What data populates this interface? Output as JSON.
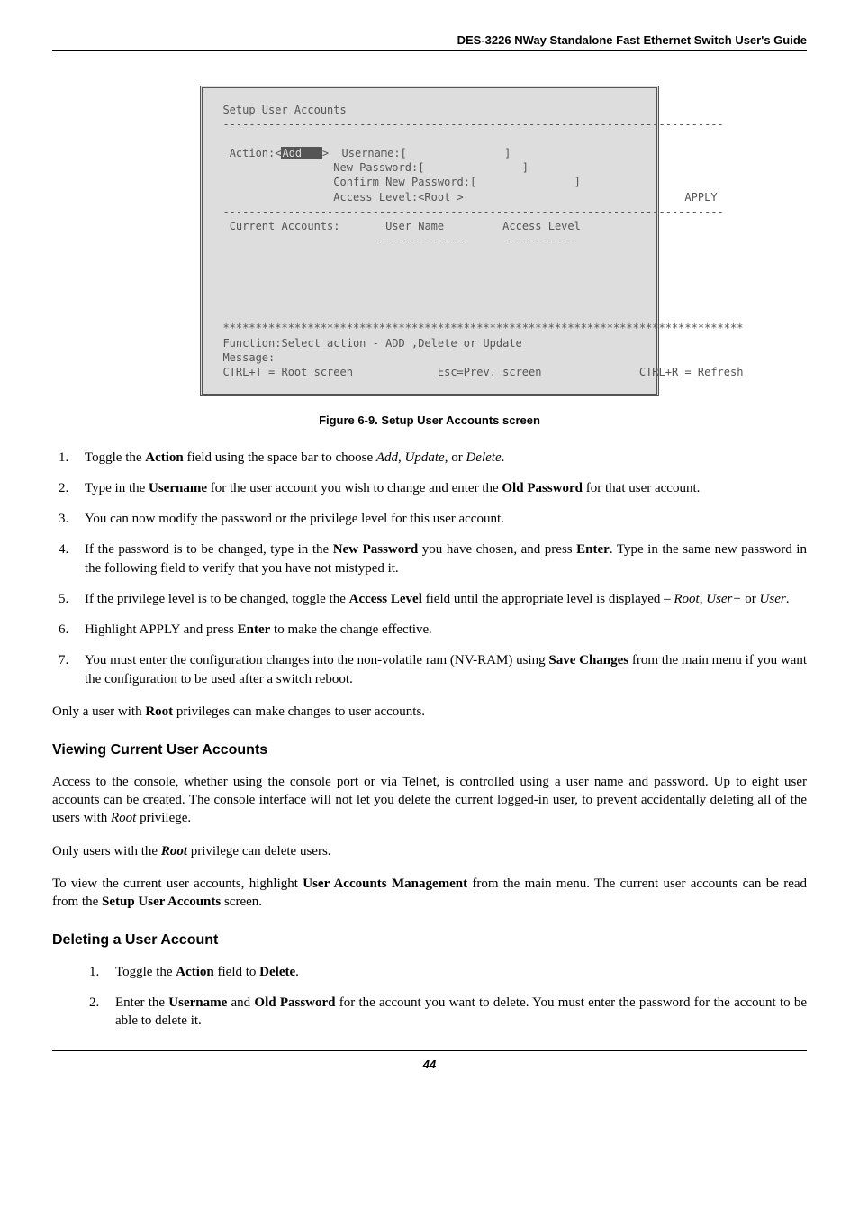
{
  "header": {
    "running_title": "DES-3226 NWay Standalone Fast Ethernet Switch User's Guide"
  },
  "terminal": {
    "title": "Setup User Accounts",
    "action_label": "Action:<",
    "action_value": "Add   ",
    "username_label": ">  Username:[               ]",
    "new_pw_label": "New Password:[               ]",
    "confirm_pw_label": "Confirm New Password:[               ]",
    "access_level_label": "Access Level:<Root >",
    "apply": "APPLY",
    "table_hdr_user": "User Name",
    "table_hdr_level": "Access Level",
    "table_accounts": "Current Accounts:",
    "func_line": "Function:Select action - ADD ,Delete or Update",
    "message_label": "Message:",
    "ctrl_t": "CTRL+T = Root screen",
    "esc": "Esc=Prev. screen",
    "ctrl_r": "CTRL+R = Refresh"
  },
  "figure_caption": "Figure 6-9.  Setup User Accounts screen",
  "steps_a": {
    "s1_p1": "Toggle the ",
    "s1_b1": "Action",
    "s1_p2": " field using the space bar to choose ",
    "s1_i1": "Add",
    "s1_p3": ", ",
    "s1_i2": "Update",
    "s1_p4": ", or ",
    "s1_i3": "Delete",
    "s1_p5": ".",
    "s2_p1": "Type in the ",
    "s2_b1": "Username",
    "s2_p2": " for the user account you wish to change and enter the ",
    "s2_b2": "Old Password",
    "s2_p3": " for that user account.",
    "s3": "You can now modify the password or the privilege level for this user account.",
    "s4_p1": "If the password is to be changed, type in the ",
    "s4_b1": "New Password",
    "s4_p2": " you have chosen, and press ",
    "s4_b2": "Enter",
    "s4_p3": ". Type in the same new password in the following field to verify that you have not mistyped it.",
    "s5_p1": "If the privilege level is to be changed, toggle the ",
    "s5_b1": "Access Level",
    "s5_p2": " field until the appropriate level is displayed – ",
    "s5_i1": "Root",
    "s5_p3": ", ",
    "s5_i2": "User+",
    "s5_p4": " or ",
    "s5_i3": "User",
    "s5_p5": ".",
    "s6_p1": "Highlight APPLY and press ",
    "s6_b1": "Enter",
    "s6_p2": " to make the change effective",
    "s6_i1": ".",
    "s7_p1": "You must enter the configuration changes into the non-volatile ram (NV-RAM) using ",
    "s7_b1": "Save Changes",
    "s7_p2": " from the main menu if you want the configuration to be used after a switch reboot."
  },
  "para_root_only_p1": "Only a user with ",
  "para_root_only_b1": "Root",
  "para_root_only_p2": " privileges can make changes to user accounts.",
  "viewing": {
    "heading": "Viewing Current User Accounts",
    "p1_a": "Access to the console, whether using the console port or via ",
    "p1_tt": "Telnet",
    "p1_b": ", is controlled using a user name and password. Up to eight user accounts can be created. The console interface will not let you delete the current logged-in user, to prevent accidentally deleting all of the users with ",
    "p1_i": "Root",
    "p1_c": " privilege.",
    "p2_a": "Only users with the ",
    "p2_b": "Root",
    "p2_c": " privilege can delete users.",
    "p3_a": "To view the current user accounts, highlight ",
    "p3_b1": "User Accounts Management",
    "p3_c": " from the main menu. The current user accounts can be read from the ",
    "p3_b2": "Setup User Accounts",
    "p3_d": " screen."
  },
  "deleting": {
    "heading": "Deleting a User Account",
    "s1_p1": "Toggle the ",
    "s1_b1": "Action",
    "s1_p2": " field to ",
    "s1_b2": "Delete",
    "s1_p3": ".",
    "s2_p1": "Enter the ",
    "s2_b1": "Username",
    "s2_p2": " and ",
    "s2_b2": "Old Password",
    "s2_p3": " for the account you want to delete. You must enter the password for the account to be able to delete it."
  },
  "page_number": "44"
}
